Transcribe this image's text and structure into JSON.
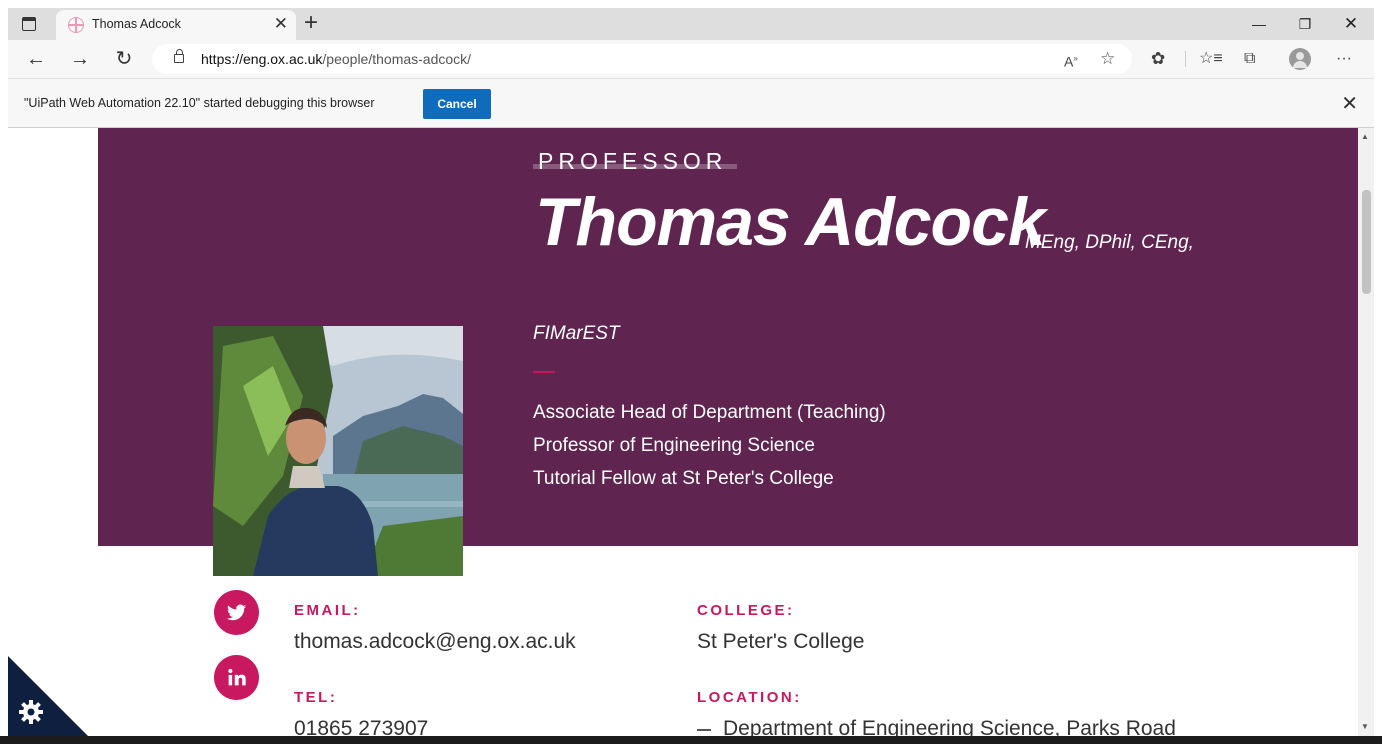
{
  "browser": {
    "tab_title": "Thomas Adcock",
    "url_host": "https://eng.ox.ac.uk",
    "url_path": "/people/thomas-adcock/",
    "infobar_message": "\"UiPath Web Automation 22.10\" started debugging this browser",
    "infobar_cancel": "Cancel"
  },
  "profile": {
    "rank": "PROFESSOR",
    "name": "Thomas Adcock",
    "qualifications_line1": "MEng, DPhil, CEng,",
    "qualifications_line2": "FIMarEST",
    "roles": [
      "Associate Head of Department (Teaching)",
      "Professor of Engineering Science",
      "Tutorial Fellow at St Peter's College"
    ]
  },
  "contact": {
    "email_label": "EMAIL:",
    "email": "thomas.adcock@eng.ox.ac.uk",
    "tel_label": "TEL:",
    "tel": "01865 273907",
    "college_label": "COLLEGE:",
    "college": "St Peter's College",
    "location_label": "LOCATION:",
    "location": "Department of Engineering Science, Parks Road"
  },
  "icons": {
    "social": [
      "twitter-icon",
      "linkedin-icon"
    ],
    "cookie": "gear-icon"
  },
  "colors": {
    "hero_bg": "#5f2450",
    "accent": "#c8185f",
    "button_blue": "#0f6cbd"
  }
}
